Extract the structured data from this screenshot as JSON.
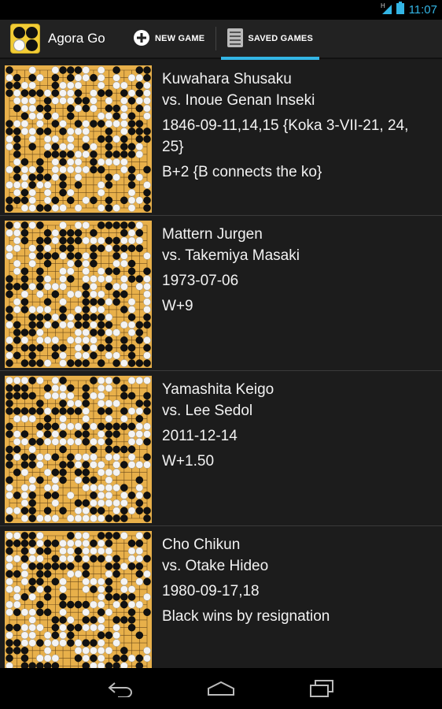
{
  "status_bar": {
    "time": "11:07",
    "signal_label": "H"
  },
  "action_bar": {
    "app_title": "Agora Go",
    "new_game_label": "NEW GAME",
    "saved_games_label": "SAVED GAMES"
  },
  "colors": {
    "accent": "#33b5e5",
    "board": "#e8b04a"
  },
  "games": [
    {
      "black": "Kuwahara Shusaku",
      "white": "vs.  Inoue Genan Inseki",
      "date": "1846-09-11,14,15 {Koka 3-VII-21, 24, 25}",
      "result": "B+2  {B connects the ko}"
    },
    {
      "black": "Mattern Jurgen",
      "white": "vs.  Takemiya Masaki",
      "date": "1973-07-06",
      "result": "W+9"
    },
    {
      "black": "Yamashita Keigo",
      "white": "vs.  Lee Sedol",
      "date": "2011-12-14",
      "result": "W+1.50"
    },
    {
      "black": "Cho Chikun",
      "white": "vs.  Otake Hideo",
      "date": "1980-09-17,18",
      "result": "Black wins by resignation"
    }
  ],
  "nav": {
    "back_icon": "back-icon",
    "home_icon": "home-icon",
    "recents_icon": "recents-icon"
  }
}
